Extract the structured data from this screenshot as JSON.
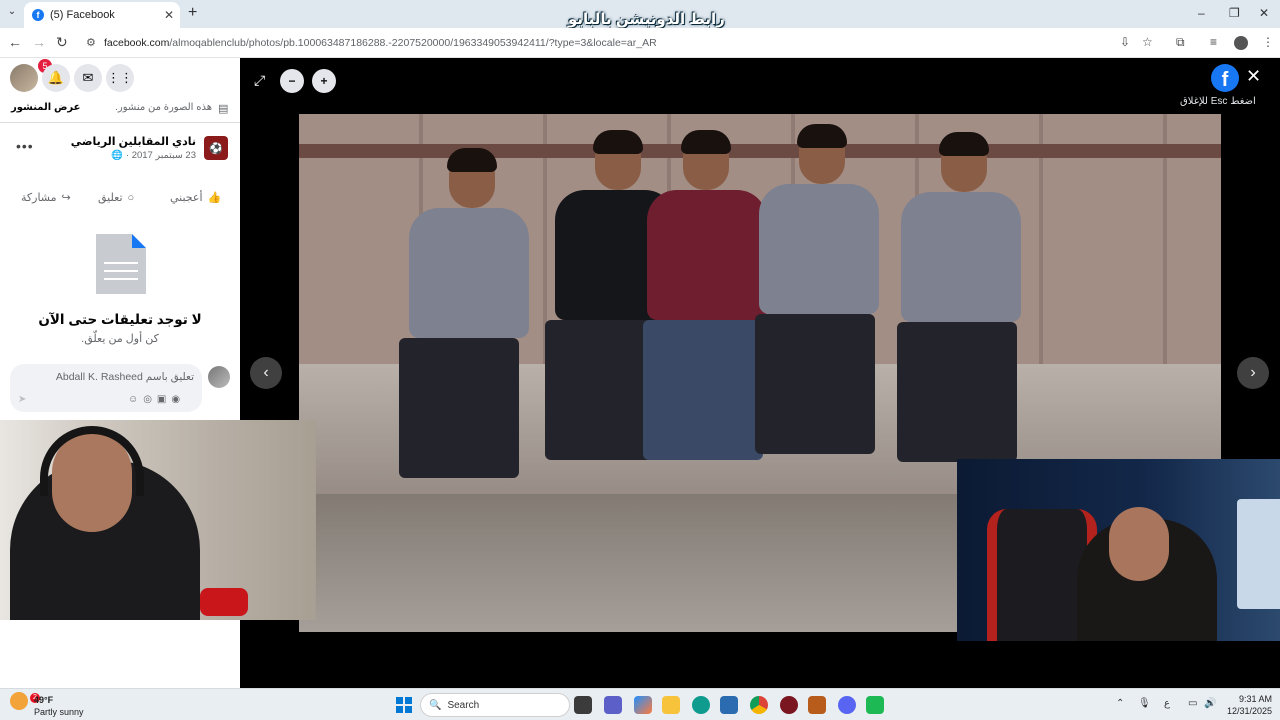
{
  "browser": {
    "tab_title": "(5) Facebook",
    "tab_close": "✕",
    "new_tab": "+",
    "tab_list": "⌄",
    "overlay_title": "رابط الدونيشن بالبايو",
    "url_host": "facebook.com",
    "url_path": "/almoqablenclub/photos/pb.100063487186288.-2207520000/1963349053942411/?type=3&locale=ar_AR",
    "minimize": "–",
    "maximize": "❐",
    "close": "✕"
  },
  "left_panel": {
    "notification_count": "5",
    "view_post": "عرض المنشور",
    "photo_from_post": "هذه الصورة من منشور.",
    "page_name": "نادي المقابلين الرياضي",
    "post_date": "23 سبتمبر 2017 · ",
    "more": "•••",
    "actions": {
      "like": "أعجبني",
      "comment": "تعليق",
      "share": "مشاركة"
    },
    "no_comments_title": "لا توجد تعليقات حتى الآن",
    "no_comments_sub": "كن أول من يعلّق.",
    "comment_placeholder": "تعليق باسم Abdall K. Rasheed"
  },
  "viewer": {
    "esc_hint": "اضغط Esc للإغلاق",
    "close": "✕",
    "prev": "‹",
    "next": "›",
    "zoom_out": "−",
    "zoom_in": "+",
    "expand": "⤢",
    "fb_letter": "f"
  },
  "taskbar": {
    "weather_temp": "49°F",
    "weather_desc": "Partly sunny",
    "weather_badge": "2",
    "search": "Search",
    "lang": "ع",
    "time": "9:31 AM",
    "date": "12/31/2025"
  },
  "colors": {
    "facebook_blue": "#1877f2",
    "notification_red": "#e41e3f"
  }
}
